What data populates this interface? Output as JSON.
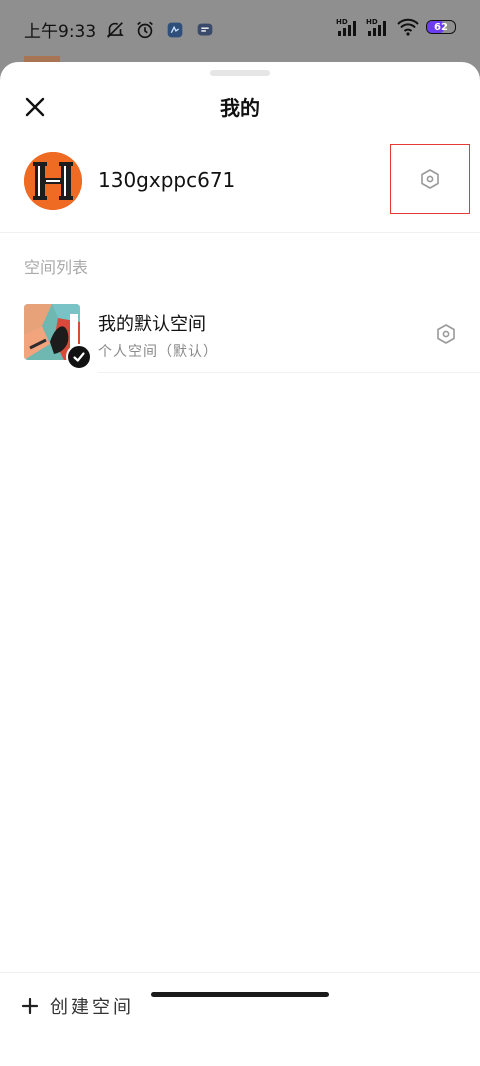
{
  "status_bar": {
    "time": "上午9:33",
    "battery_level": "62",
    "icons": [
      "mute-bell-icon",
      "alarm-icon",
      "app-notification-icon",
      "message-icon",
      "hd-signal-icon",
      "hd-signal-icon",
      "wifi-icon",
      "battery-icon"
    ]
  },
  "header": {
    "title": "我的",
    "close_icon": "close-icon"
  },
  "profile": {
    "username": "130gxppc671",
    "avatar_icon": "avatar-h-logo",
    "settings_icon": "gear-icon"
  },
  "space_list": {
    "section_label": "空间列表",
    "items": [
      {
        "name": "我的默认空间",
        "subtitle": "个人空间（默认）",
        "selected": true,
        "settings_icon": "gear-icon"
      }
    ]
  },
  "footer": {
    "create_label": "创建空间",
    "create_icon": "plus-icon"
  },
  "colors": {
    "accent_avatar": "#ef6a22",
    "highlight_box": "#e53935",
    "battery_fill": "#6b3cf0"
  }
}
